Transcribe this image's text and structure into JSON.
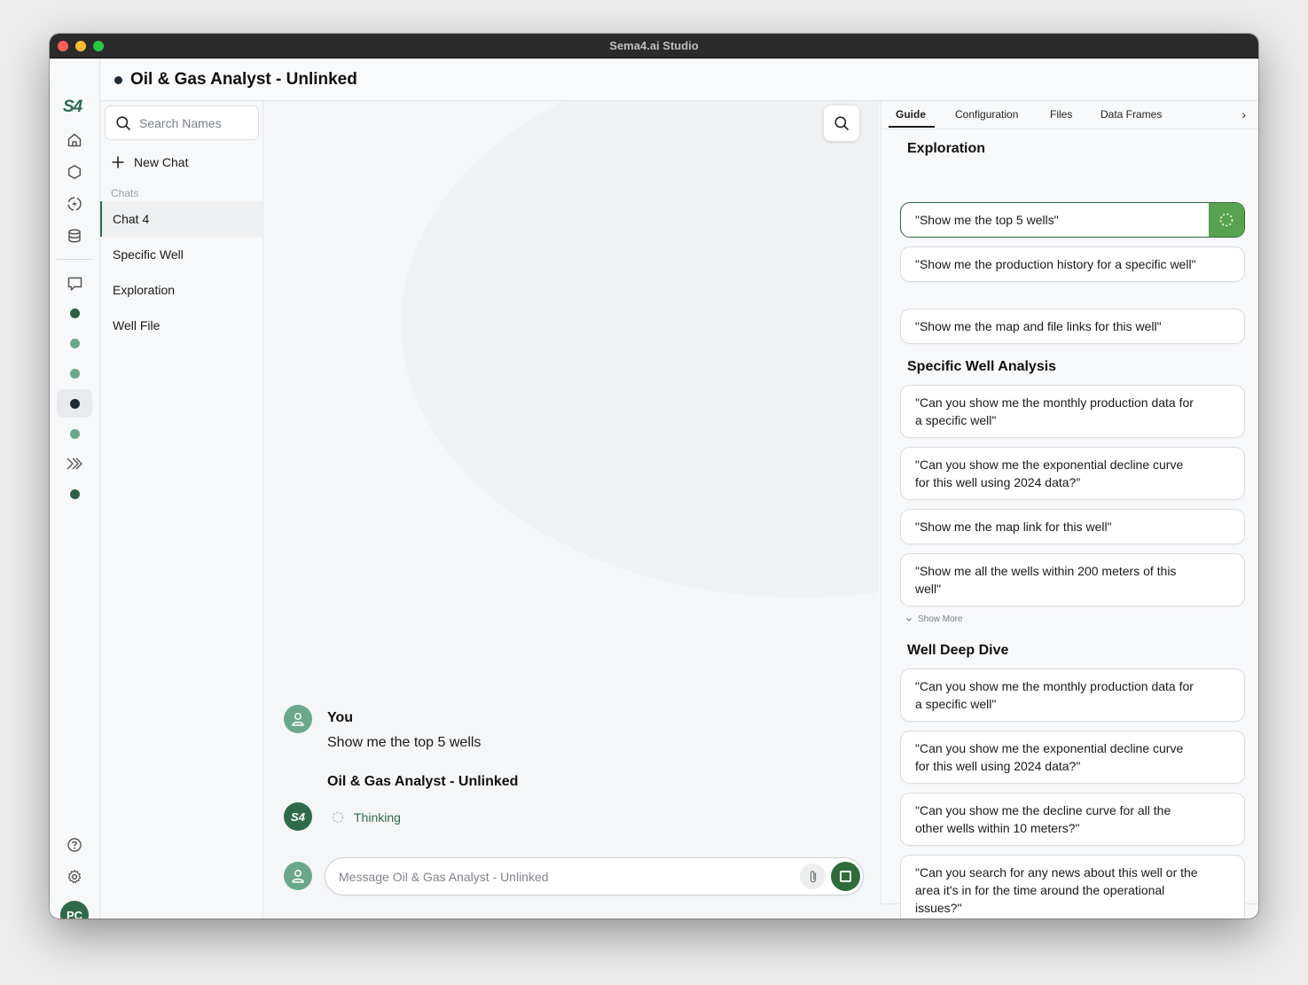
{
  "window": {
    "title": "Sema4.ai Studio"
  },
  "rail": {
    "logo": "S4",
    "avatar_initials": "PC",
    "colors": {
      "brand": "#2f6b4b",
      "dot_dark": "#2f5e46",
      "dot_light": "#6aa88c",
      "dot_active": "#1f2a36"
    }
  },
  "header": {
    "title": "Oil & Gas Analyst - Unlinked"
  },
  "chatlist": {
    "search_placeholder": "Search Names",
    "new_chat_label": "New Chat",
    "section_label": "Chats",
    "items": [
      {
        "label": "Chat 4"
      },
      {
        "label": "Specific Well"
      },
      {
        "label": "Exploration"
      },
      {
        "label": "Well File"
      }
    ]
  },
  "conversation": {
    "user_name": "You",
    "user_message": "Show me the top 5 wells",
    "agent_name": "Oil & Gas Analyst - Unlinked",
    "agent_avatar": "S4",
    "status": "Thinking",
    "composer_placeholder": "Message Oil & Gas Analyst - Unlinked"
  },
  "panel": {
    "tabs": [
      {
        "label": "Guide"
      },
      {
        "label": "Configuration"
      },
      {
        "label": "Files"
      },
      {
        "label": "Data Frames"
      }
    ],
    "sections": [
      {
        "title": "Exploration",
        "prompts": [
          "\"Show me the top 5 wells\"",
          "\"Show me the production history for a specific well\"",
          "\"Show me the map and file links for this well\""
        ]
      },
      {
        "title": "Specific Well Analysis",
        "prompts": [
          "\"Can you show me the monthly production data for a specific well\"",
          "\"Can you show me the exponential decline curve for this well using 2024 data?\"",
          "\"Show me the map link for this well\"",
          "\"Show me all the wells within 200 meters of this well\""
        ],
        "show_more": "Show More"
      },
      {
        "title": "Well Deep Dive",
        "prompts": [
          "\"Can you show me the monthly production data for a specific well\"",
          "\"Can you show me the exponential decline curve for this well using 2024 data?\"",
          "\"Can you show me the decline curve for all the other wells within 10 meters?\"",
          "\"Can you search for any news about this well or the area it's in for the time around the operational issues?\""
        ]
      }
    ]
  }
}
